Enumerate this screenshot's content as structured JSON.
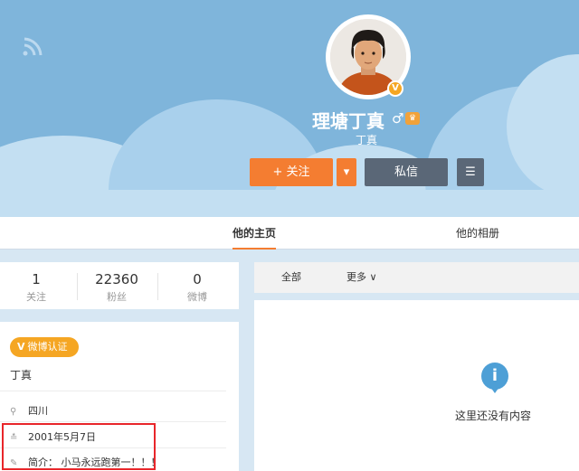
{
  "profile": {
    "username": "理塘丁真",
    "subname": "丁真",
    "gender_icon": "♂",
    "verified_icon": "V",
    "vip_icon": "♛"
  },
  "actions": {
    "follow_label": "+ 关注",
    "dropdown_icon": "▾",
    "message_label": "私信",
    "menu_icon": "☰"
  },
  "tabs": [
    {
      "label": "他的主页",
      "active": true
    },
    {
      "label": "他的相册",
      "active": false
    }
  ],
  "stats": [
    {
      "value": "1",
      "label": "关注"
    },
    {
      "value": "22360",
      "label": "粉丝"
    },
    {
      "value": "0",
      "label": "微博"
    }
  ],
  "info": {
    "badge": "微博认证",
    "badge_icon": "V",
    "name": "丁真",
    "location": "四川",
    "birthday": "2001年5月7日",
    "bio": "简介：  小马永远跑第一！！！"
  },
  "filters": {
    "all_label": "全部",
    "more_label": "更多 ∨"
  },
  "empty": {
    "icon": "i",
    "text": "这里还没有内容"
  },
  "colors": {
    "accent": "#f47d31",
    "banner": "#7fb5db",
    "secondary_button": "#5a6777",
    "badge": "#f5a623",
    "highlight": "#e8262a"
  }
}
